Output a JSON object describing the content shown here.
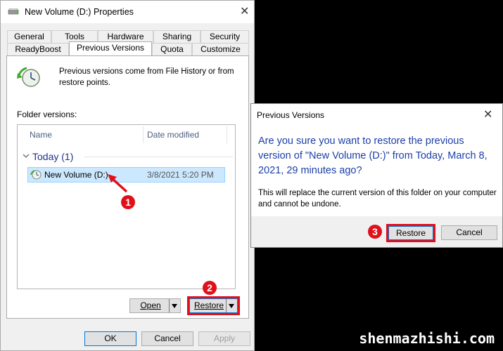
{
  "properties_window": {
    "title": "New Volume (D:) Properties",
    "tabs_row1": [
      "General",
      "Tools",
      "Hardware",
      "Sharing",
      "Security"
    ],
    "tabs_row2": [
      "ReadyBoost",
      "Previous Versions",
      "Quota",
      "Customize"
    ],
    "active_tab": "Previous Versions",
    "description": "Previous versions come from File History or from restore points.",
    "folder_versions_label": "Folder versions:",
    "columns": [
      "Name",
      "Date modified"
    ],
    "group_label": "Today (1)",
    "rows": [
      {
        "name": "New Volume (D:)",
        "date": "3/8/2021 5:20 PM",
        "selected": true
      }
    ],
    "open_button": "Open",
    "restore_button": "Restore",
    "footer_buttons": {
      "ok": "OK",
      "cancel": "Cancel",
      "apply": "Apply"
    }
  },
  "confirm_dialog": {
    "title": "Previous Versions",
    "question": "Are you sure you want to restore the previous version of \"New Volume (D:)\" from Today, March 8, 2021, 29 minutes ago?",
    "detail": "This will replace the current version of this folder on your computer and cannot be undone.",
    "restore_button": "Restore",
    "cancel_button": "Cancel"
  },
  "step_markers": [
    "1",
    "2",
    "3"
  ],
  "watermark": "shenmazhishi.com",
  "colors": {
    "highlight": "#e0101a",
    "accent": "#1c3fa8",
    "selection": "#cce8ff"
  }
}
